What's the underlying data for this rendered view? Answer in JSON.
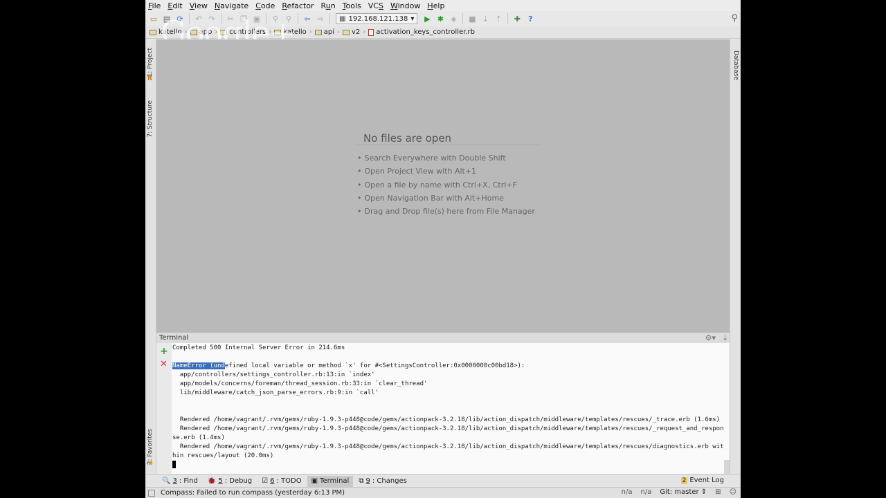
{
  "menu": [
    {
      "label": "File",
      "u": "F"
    },
    {
      "label": "Edit",
      "u": "E"
    },
    {
      "label": "View",
      "u": "V"
    },
    {
      "label": "Navigate",
      "u": "N"
    },
    {
      "label": "Code",
      "u": "C"
    },
    {
      "label": "Refactor",
      "u": "R"
    },
    {
      "label": "Run",
      "u": "u"
    },
    {
      "label": "Tools",
      "u": "T"
    },
    {
      "label": "VCS",
      "u": "S"
    },
    {
      "label": "Window",
      "u": "W"
    },
    {
      "label": "Help",
      "u": "H"
    }
  ],
  "toolbar": {
    "run_config": "192.168.121.138"
  },
  "breadcrumb": {
    "items": [
      "katello",
      "app",
      "controllers",
      "katello",
      "api",
      "v2"
    ],
    "file": "activation_keys_controller.rb"
  },
  "watermark": "Google+",
  "side_tabs": {
    "project": "1: Project",
    "structure": "7: Structure",
    "favorites": "2: Favorites",
    "database": "Database"
  },
  "editor": {
    "empty_title": "No files are open",
    "hints": [
      "Search Everywhere with Double Shift",
      "Open Project View with Alt+1",
      "Open a file by name with Ctrl+X, Ctrl+F",
      "Open Navigation Bar with Alt+Home",
      "Drag and Drop file(s) here from File Manager"
    ]
  },
  "terminal": {
    "title": "Terminal",
    "line1": "Completed 500 Internal Server Error in 214.6ms",
    "line2_sel": "NameError (und",
    "line2_rest": "efined local variable or method `x' for #<SettingsController:0x0000000c00bd18>):",
    "lines": [
      "  app/controllers/settings_controller.rb:13:in `index'",
      "  app/models/concerns/foreman/thread_session.rb:33:in `clear_thread'",
      "  lib/middleware/catch_json_parse_errors.rb:9:in `call'",
      "",
      "",
      "  Rendered /home/vagrant/.rvm/gems/ruby-1.9.3-p448@code/gems/actionpack-3.2.18/lib/action_dispatch/middleware/templates/rescues/_trace.erb (1.6ms)",
      "  Rendered /home/vagrant/.rvm/gems/ruby-1.9.3-p448@code/gems/actionpack-3.2.18/lib/action_dispatch/middleware/templates/rescues/_request_and_respon",
      "se.erb (1.4ms)",
      "  Rendered /home/vagrant/.rvm/gems/ruby-1.9.3-p448@code/gems/actionpack-3.2.18/lib/action_dispatch/middleware/templates/rescues/diagnostics.erb wit",
      "hin rescues/layout (20.0ms)"
    ]
  },
  "bottom_tabs": [
    {
      "num": "3",
      "label": ": Find",
      "icon": "🔍"
    },
    {
      "num": "5",
      "label": ": Debug",
      "icon": "🐞"
    },
    {
      "num": "6",
      "label": ": TODO",
      "icon": "☑"
    },
    {
      "num": "",
      "label": "Terminal",
      "icon": "▣"
    },
    {
      "num": "9",
      "label": ": Changes",
      "icon": "⧉"
    }
  ],
  "event_log": {
    "count": "2",
    "label": "Event Log"
  },
  "status": {
    "message": "Compass: Failed to run compass (yesterday 6:13 PM)",
    "na1": "n/a",
    "na2": "n/a",
    "git": "Git: master ⇕"
  }
}
